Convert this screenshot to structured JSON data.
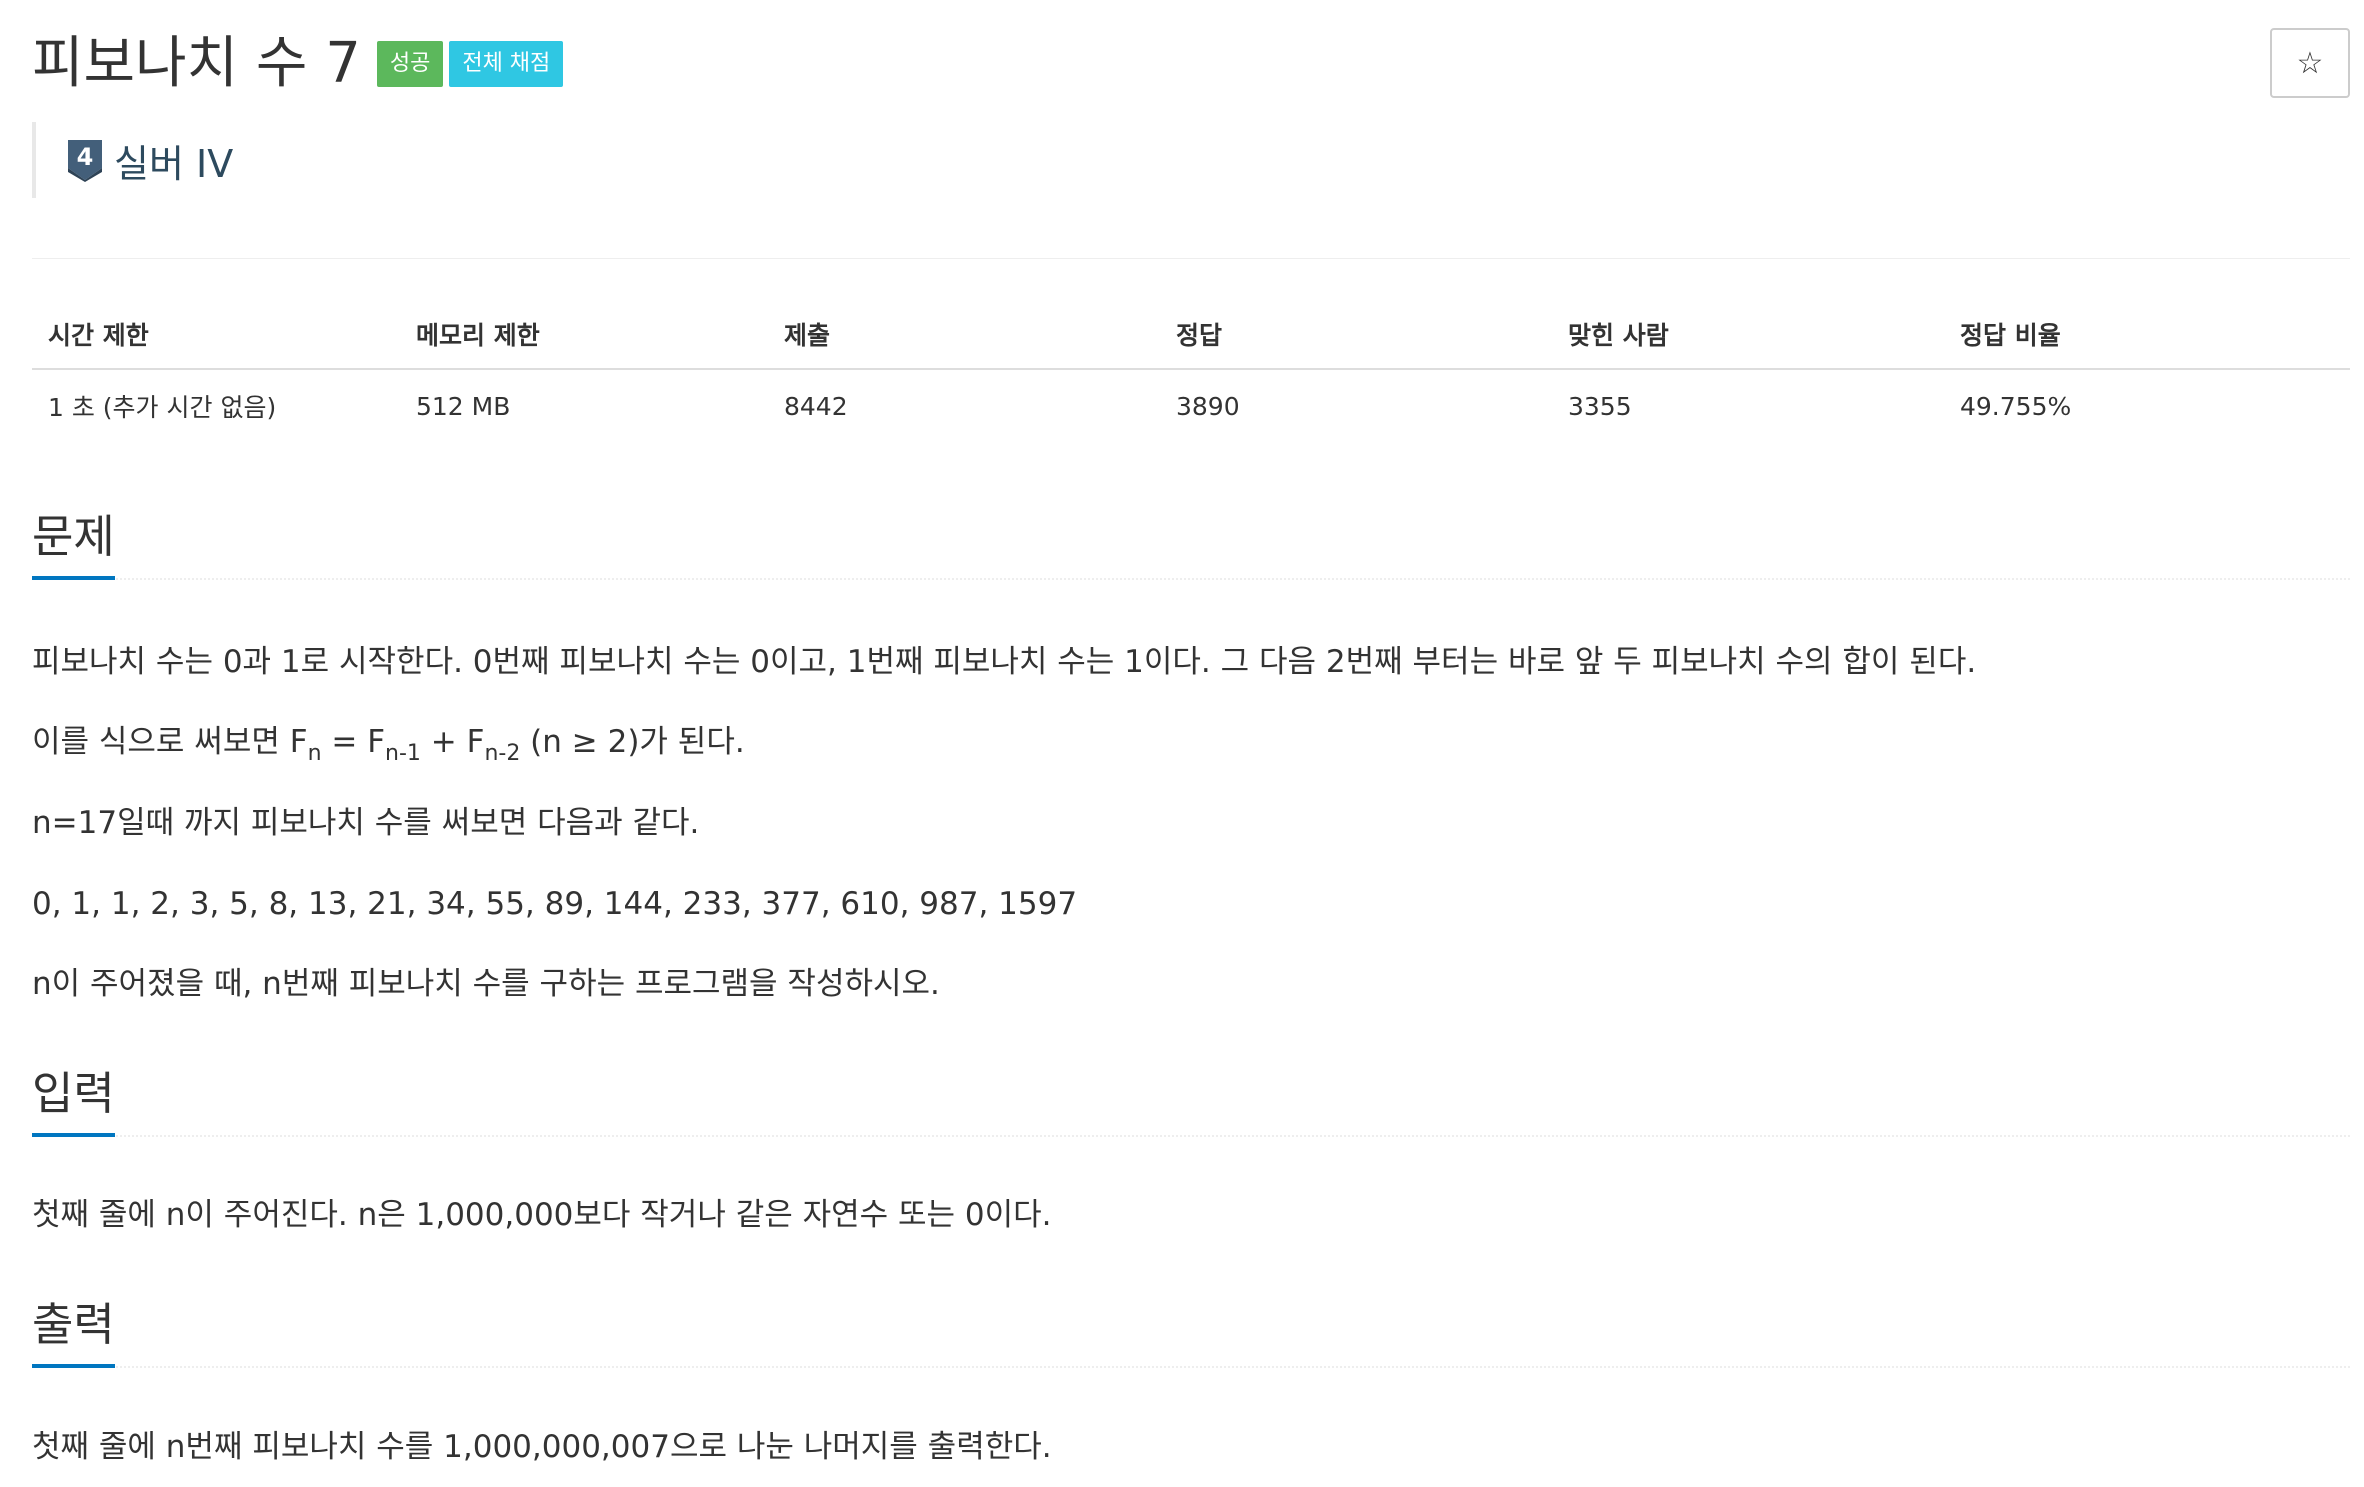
{
  "problem": {
    "title": "피보나치 수 7",
    "badges": [
      "성공",
      "전체 채점"
    ],
    "tier": {
      "number": "4",
      "label": "실버 IV"
    },
    "star_label": "☆"
  },
  "stats": {
    "headers": [
      "시간 제한",
      "메모리 제한",
      "제출",
      "정답",
      "맞힌 사람",
      "정답 비율"
    ],
    "values": [
      "1 초 (추가 시간 없음)",
      "512 MB",
      "8442",
      "3890",
      "3355",
      "49.755%"
    ]
  },
  "sections": {
    "problem": {
      "heading": "문제",
      "p1": "피보나치 수는 0과 1로 시작한다. 0번째 피보나치 수는 0이고, 1번째 피보나치 수는 1이다. 그 다음 2번째 부터는 바로 앞 두 피보나치 수의 합이 된다.",
      "p2": {
        "prefix": "이를 식으로 써보면 F",
        "sub_n": "n",
        "eq": " = F",
        "sub_n1": "n-1",
        "plus": " + F",
        "sub_n2": "n-2",
        "suffix": " (n ≥ 2)가 된다."
      },
      "p3": "n=17일때 까지 피보나치 수를 써보면 다음과 같다.",
      "p4": "0, 1, 1, 2, 3, 5, 8, 13, 21, 34, 55, 89, 144, 233, 377, 610, 987, 1597",
      "p5": "n이 주어졌을 때, n번째 피보나치 수를 구하는 프로그램을 작성하시오."
    },
    "input": {
      "heading": "입력",
      "p1": "첫째 줄에 n이 주어진다. n은 1,000,000보다 작거나 같은 자연수 또는 0이다."
    },
    "output": {
      "heading": "출력",
      "p1": "첫째 줄에 n번째 피보나치 수를 1,000,000,007으로 나눈 나머지를 출력한다."
    }
  },
  "colors": {
    "success": "#5cb85c",
    "info": "#2fc7e3",
    "tier": "#435f7a",
    "section_underline": "#0076c0"
  }
}
